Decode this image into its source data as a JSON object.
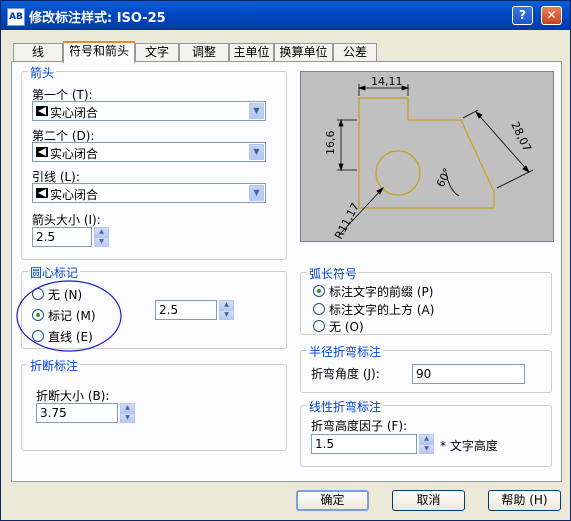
{
  "window": {
    "app_icon": "AB",
    "title": "修改标注样式: ISO-25"
  },
  "titlebar_buttons": {
    "help": "?",
    "close": "✕"
  },
  "tabs": [
    "线",
    "符号和箭头",
    "文字",
    "调整",
    "主单位",
    "换算单位",
    "公差"
  ],
  "arrowheads": {
    "title": "箭头",
    "first_label": "第一个 (T):",
    "first_value": "实心闭合",
    "second_label": "第二个 (D):",
    "second_value": "实心闭合",
    "leader_label": "引线 (L):",
    "leader_value": "实心闭合",
    "size_label": "箭头大小 (I):",
    "size_value": "2.5"
  },
  "preview": {
    "dim_top": "14,11",
    "dim_left": "16,6",
    "dim_right": "28,07",
    "dim_angle": "60°",
    "dim_radius": "R11,17"
  },
  "center_marks": {
    "title": "圆心标记",
    "options": [
      "无 (N)",
      "标记 (M)",
      "直线 (E)"
    ],
    "selected": 1,
    "size_value": "2.5"
  },
  "dimension_break": {
    "title": "折断标注",
    "size_label": "折断大小 (B):",
    "size_value": "3.75"
  },
  "arc_length_symbol": {
    "title": "弧长符号",
    "options": [
      "标注文字的前缀 (P)",
      "标注文字的上方 (A)",
      "无 (O)"
    ],
    "selected": 0
  },
  "radius_jog": {
    "title": "半径折弯标注",
    "angle_label": "折弯角度 (J):",
    "angle_value": "90"
  },
  "linear_jog": {
    "title": "线性折弯标注",
    "factor_label": "折弯高度因子 (F):",
    "factor_value": "1.5",
    "suffix": "* 文字高度"
  },
  "footer": {
    "ok": "确定",
    "cancel": "取消",
    "help": "帮助 (H)"
  },
  "colors": {
    "title_bar": "#0a5fd8",
    "group_title": "#0046d5",
    "preview_bg": "#c0c0c0",
    "preview_shape": "#c8a020",
    "annotation_circle": "#1c1cc8"
  }
}
